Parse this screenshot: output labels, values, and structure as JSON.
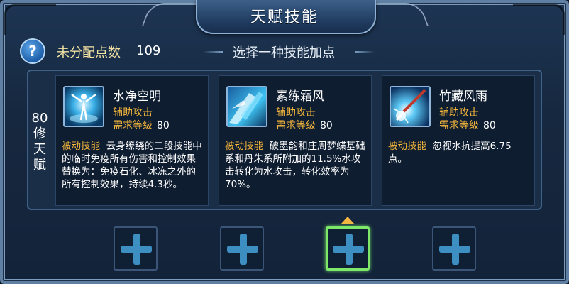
{
  "window": {
    "title": "天赋技能"
  },
  "header": {
    "help_symbol": "?",
    "points_label": "未分配点数",
    "points_value": "109",
    "hint": "选择一种技能加点"
  },
  "tier": {
    "label_chars": [
      "80",
      "修",
      "天",
      "赋"
    ]
  },
  "skills": [
    {
      "name": "水净空明",
      "icon": "water-figure-icon",
      "type": "辅助攻击",
      "req_label": "需求等级",
      "req_value": "80",
      "desc_tag": "被动技能",
      "desc_text": "云身缭绕的二段技能中的临时免疫所有伤害和控制效果替换为：免疫石化、冰冻之外的所有控制效果，持续4.3秒。"
    },
    {
      "name": "素练霜风",
      "icon": "ice-shard-icon",
      "type": "辅助攻击",
      "req_label": "需求等级",
      "req_value": "80",
      "desc_tag": "被动技能",
      "desc_text": "破墨韵和庄周梦蝶基础系和丹朱系所附加的11.5%水攻击转化为水攻击，转化效率为70%。"
    },
    {
      "name": "竹藏风雨",
      "icon": "brush-strike-icon",
      "type": "辅助攻击",
      "req_label": "需求等级",
      "req_value": "80",
      "desc_tag": "被动技能",
      "desc_text": "忽视水抗提高6.75点。"
    }
  ],
  "slots": [
    {
      "state": "empty"
    },
    {
      "state": "empty"
    },
    {
      "state": "selected"
    },
    {
      "state": "empty"
    }
  ],
  "colors": {
    "accent_gold": "#f5b73b",
    "selected_green": "#7ee86a",
    "plus_blue": "#3d8fc2"
  }
}
